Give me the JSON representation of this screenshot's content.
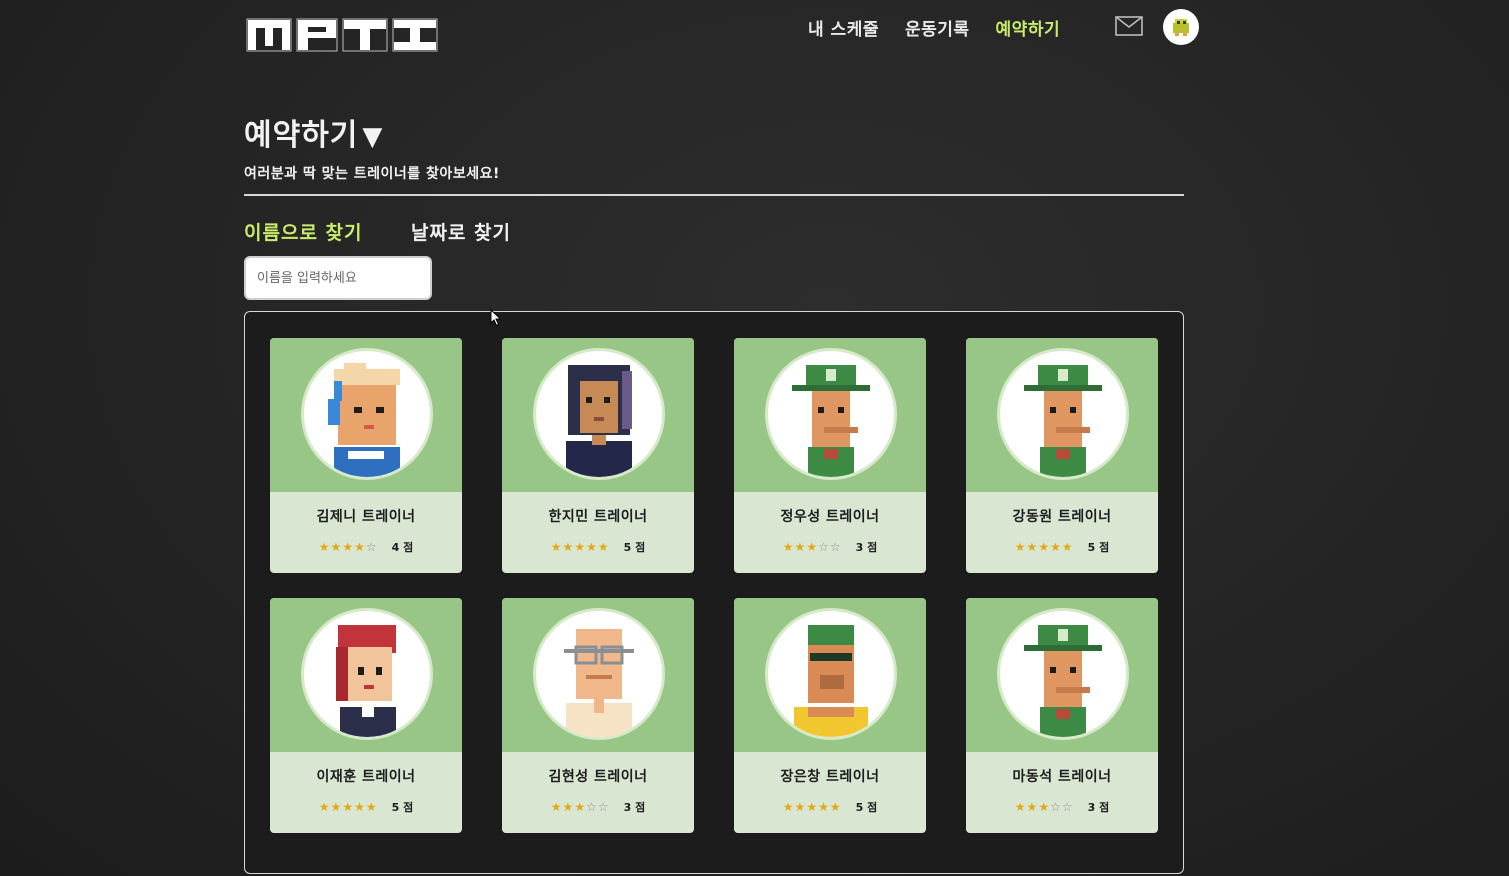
{
  "header": {
    "logo": "MPTI",
    "nav": [
      {
        "label": "내 스케줄",
        "active": false
      },
      {
        "label": "운동기록",
        "active": false
      },
      {
        "label": "예약하기",
        "active": true
      }
    ],
    "mail_icon": "mail-icon",
    "profile_icon": "user-avatar-icon"
  },
  "page": {
    "title": "예약하기",
    "title_arrow": "▼",
    "subtitle": "여러분과 딱 맞는 트레이너를 찾아보세요!",
    "tabs": [
      {
        "label": "이름으로 찾기",
        "active": true
      },
      {
        "label": "날짜로 찾기",
        "active": false
      }
    ],
    "search": {
      "placeholder": "이름을 입력하세요",
      "value": ""
    }
  },
  "colors": {
    "accent": "#c9ec6b",
    "card_top": "#97c686",
    "card_bottom": "#d9e6d2",
    "star": "#e3a719"
  },
  "trainers": [
    {
      "name": "김제니 트레이너",
      "rating": 4,
      "score": "4 점",
      "avatar": "headset-girl-avatar"
    },
    {
      "name": "한지민 트레이너",
      "rating": 5,
      "score": "5 점",
      "avatar": "dark-hair-woman-avatar"
    },
    {
      "name": "정우성 트레이너",
      "rating": 3,
      "score": "3 점",
      "avatar": "green-cap-man-avatar"
    },
    {
      "name": "강동원 트레이너",
      "rating": 5,
      "score": "5 점",
      "avatar": "green-cap-man-avatar"
    },
    {
      "name": "이재훈 트레이너",
      "rating": 5,
      "score": "5 점",
      "avatar": "red-hair-girl-avatar"
    },
    {
      "name": "김현성 트레이너",
      "rating": 3,
      "score": "3 점",
      "avatar": "bald-glasses-man-avatar"
    },
    {
      "name": "장은창 트레이너",
      "rating": 5,
      "score": "5 점",
      "avatar": "sunglasses-man-avatar"
    },
    {
      "name": "마동석 트레이너",
      "rating": 3,
      "score": "3 점",
      "avatar": "green-cap-man-avatar"
    }
  ]
}
